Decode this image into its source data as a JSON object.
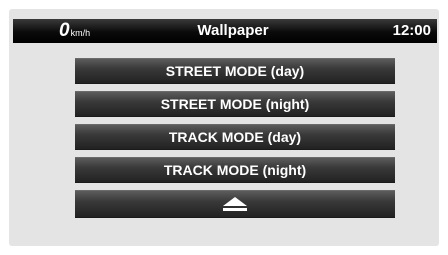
{
  "header": {
    "speed_value": "0",
    "speed_unit": "km/h",
    "title": "Wallpaper",
    "clock": "12:00"
  },
  "menu": {
    "items": [
      {
        "label": "STREET MODE (day)"
      },
      {
        "label": "STREET MODE (night)"
      },
      {
        "label": "TRACK MODE (day)"
      },
      {
        "label": "TRACK MODE (night)"
      }
    ],
    "eject_icon": "eject-icon"
  },
  "colors": {
    "status_bar": "#000000",
    "screen_background": "#e4e4e4",
    "button_top": "#5c5c5c",
    "button_bottom": "#222222",
    "text": "#ffffff"
  }
}
